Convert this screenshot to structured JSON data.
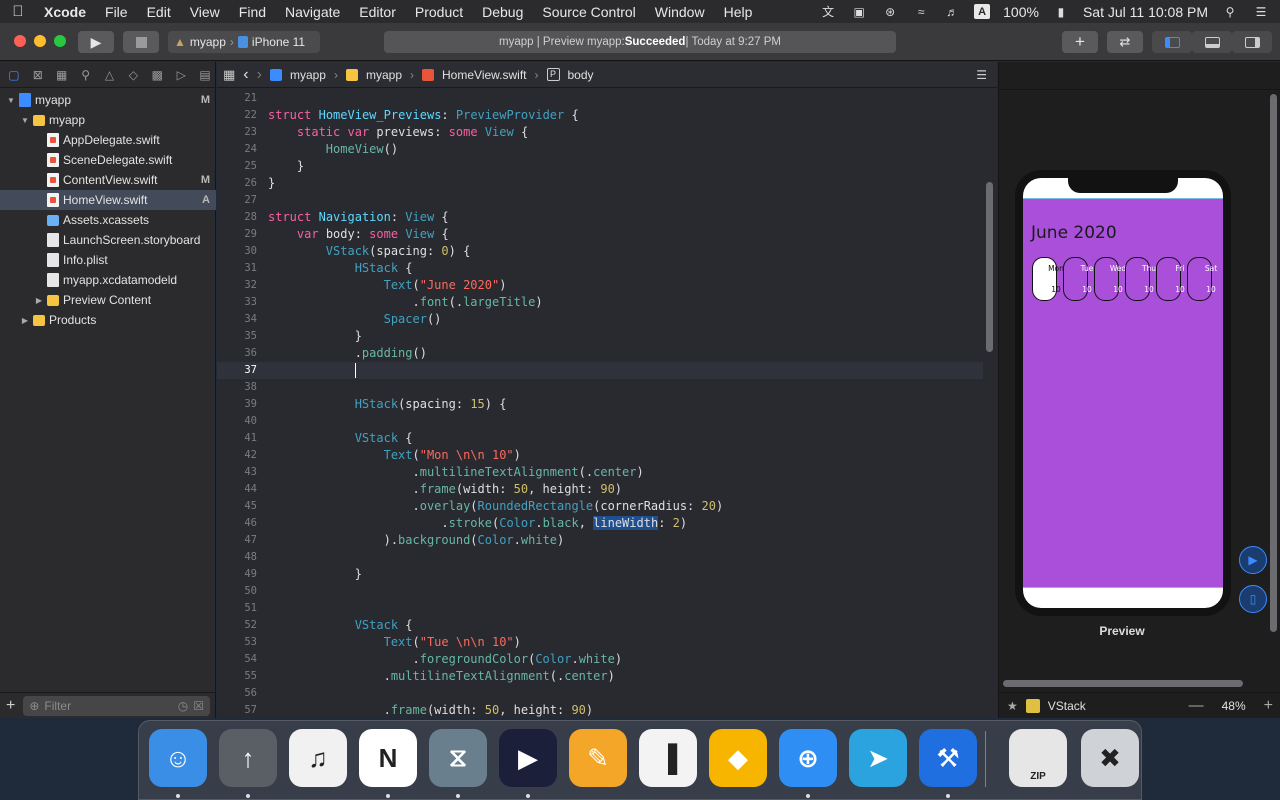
{
  "menubar": {
    "items": [
      "Xcode",
      "File",
      "Edit",
      "View",
      "Find",
      "Navigate",
      "Editor",
      "Product",
      "Debug",
      "Source Control",
      "Window",
      "Help"
    ],
    "battery": "100%",
    "clock": "Sat Jul 11  10:08 PM",
    "input_source": "A"
  },
  "toolbar": {
    "scheme": "myapp",
    "device": "iPhone 11",
    "activity_prefix": "myapp | Preview myapp: ",
    "activity_status": "Succeeded",
    "activity_suffix": " | Today at 9:27 PM"
  },
  "navigator": {
    "items": [
      {
        "label": "myapp",
        "badge": "M",
        "kind": "proj",
        "level": 0,
        "disclosure": "open"
      },
      {
        "label": "myapp",
        "badge": "",
        "kind": "folder",
        "level": 1,
        "disclosure": "open"
      },
      {
        "label": "AppDelegate.swift",
        "badge": "",
        "kind": "swift",
        "level": 2,
        "disclosure": ""
      },
      {
        "label": "SceneDelegate.swift",
        "badge": "",
        "kind": "swift",
        "level": 2,
        "disclosure": ""
      },
      {
        "label": "ContentView.swift",
        "badge": "M",
        "kind": "swift",
        "level": 2,
        "disclosure": ""
      },
      {
        "label": "HomeView.swift",
        "badge": "A",
        "kind": "swift",
        "level": 2,
        "disclosure": "",
        "selected": true
      },
      {
        "label": "Assets.xcassets",
        "badge": "",
        "kind": "assets",
        "level": 2,
        "disclosure": ""
      },
      {
        "label": "LaunchScreen.storyboard",
        "badge": "",
        "kind": "doc",
        "level": 2,
        "disclosure": ""
      },
      {
        "label": "Info.plist",
        "badge": "",
        "kind": "doc",
        "level": 2,
        "disclosure": ""
      },
      {
        "label": "myapp.xcdatamodeld",
        "badge": "",
        "kind": "doc",
        "level": 2,
        "disclosure": ""
      },
      {
        "label": "Preview Content",
        "badge": "",
        "kind": "folder",
        "level": 2,
        "disclosure": "closed"
      },
      {
        "label": "Products",
        "badge": "",
        "kind": "folder",
        "level": 1,
        "disclosure": "closed"
      }
    ],
    "filter_placeholder": "Filter"
  },
  "jumpbar": {
    "crumbs": [
      "myapp",
      "myapp",
      "HomeView.swift",
      "body"
    ]
  },
  "code": {
    "current_line": 37,
    "lines": [
      {
        "n": 21,
        "html": ""
      },
      {
        "n": 22,
        "html": "<span class='kw'>struct</span> <span class='dec'>HomeView_Previews</span>: <span class='tyn'>PreviewProvider</span> {"
      },
      {
        "n": 23,
        "html": "    <span class='kw'>static</span> <span class='kw'>var</span> previews: <span class='kw'>some</span> <span class='tyn'>View</span> {"
      },
      {
        "n": 24,
        "html": "        <span class='fn'>HomeView</span>()"
      },
      {
        "n": 25,
        "html": "    }"
      },
      {
        "n": 26,
        "html": "}"
      },
      {
        "n": 27,
        "html": ""
      },
      {
        "n": 28,
        "html": "<span class='kw'>struct</span> <span class='dec'>Navigation</span>: <span class='tyn'>View</span> {"
      },
      {
        "n": 29,
        "html": "    <span class='kw'>var</span> body: <span class='kw'>some</span> <span class='tyn'>View</span> {"
      },
      {
        "n": 30,
        "html": "        <span class='tyn'>VStack</span>(spacing: <span class='num'>0</span>) {"
      },
      {
        "n": 31,
        "html": "            <span class='tyn'>HStack</span> {"
      },
      {
        "n": 32,
        "html": "                <span class='tyn'>Text</span>(<span class='str'>\"June 2020\"</span>)"
      },
      {
        "n": 33,
        "html": "                    .<span class='fn'>font</span>(.<span class='fn'>largeTitle</span>)"
      },
      {
        "n": 34,
        "html": "                <span class='tyn'>Spacer</span>()"
      },
      {
        "n": 35,
        "html": "            }"
      },
      {
        "n": 36,
        "html": "            .<span class='fn'>padding</span>()"
      },
      {
        "n": 37,
        "html": "            <span class='cursor'></span>"
      },
      {
        "n": 38,
        "html": ""
      },
      {
        "n": 39,
        "html": "            <span class='tyn'>HStack</span>(spacing: <span class='num'>15</span>) {"
      },
      {
        "n": 40,
        "html": ""
      },
      {
        "n": 41,
        "html": "            <span class='tyn'>VStack</span> {"
      },
      {
        "n": 42,
        "html": "                <span class='tyn'>Text</span>(<span class='str'>\"Mon \\n\\n 10\"</span>)"
      },
      {
        "n": 43,
        "html": "                    .<span class='fn'>multilineTextAlignment</span>(.<span class='fn'>center</span>)"
      },
      {
        "n": 44,
        "html": "                    .<span class='fn'>frame</span>(width: <span class='num'>50</span>, height: <span class='num'>90</span>)"
      },
      {
        "n": 45,
        "html": "                    .<span class='fn'>overlay</span>(<span class='tyn'>RoundedRectangle</span>(cornerRadius: <span class='num'>20</span>)"
      },
      {
        "n": 46,
        "html": "                        .<span class='fn'>stroke</span>(<span class='tyn'>Color</span>.<span class='fn'>black</span>, <span class='hl'>lineWidth</span>: <span class='num'>2</span>)"
      },
      {
        "n": 47,
        "html": "                ).<span class='fn'>background</span>(<span class='tyn'>Color</span>.<span class='fn'>white</span>)"
      },
      {
        "n": 48,
        "html": ""
      },
      {
        "n": 49,
        "html": "            }"
      },
      {
        "n": 50,
        "html": ""
      },
      {
        "n": 51,
        "html": ""
      },
      {
        "n": 52,
        "html": "            <span class='tyn'>VStack</span> {"
      },
      {
        "n": 53,
        "html": "                <span class='tyn'>Text</span>(<span class='str'>\"Tue \\n\\n 10\"</span>)"
      },
      {
        "n": 54,
        "html": "                    .<span class='fn'>foregroundColor</span>(<span class='tyn'>Color</span>.<span class='fn'>white</span>)"
      },
      {
        "n": 55,
        "html": "                .<span class='fn'>multilineTextAlignment</span>(.<span class='fn'>center</span>)"
      },
      {
        "n": 56,
        "html": ""
      },
      {
        "n": 57,
        "html": "                .<span class='fn'>frame</span>(width: <span class='num'>50</span>, height: <span class='num'>90</span>)"
      }
    ]
  },
  "preview": {
    "title": "June 2020",
    "days": [
      {
        "name": "Mon",
        "date": "10",
        "selected": true
      },
      {
        "name": "Tue",
        "date": "10",
        "selected": false
      },
      {
        "name": "Wed",
        "date": "10",
        "selected": false
      },
      {
        "name": "Thu",
        "date": "10",
        "selected": false
      },
      {
        "name": "Fri",
        "date": "10",
        "selected": false
      },
      {
        "name": "Sat",
        "date": "10",
        "selected": false
      }
    ],
    "label": "Preview",
    "background_color": "#a94fd9"
  },
  "canvas_bottom": {
    "selection": "VStack",
    "zoom": "48%"
  },
  "dock": {
    "apps": [
      {
        "name": "finder-icon",
        "color": "#3a8ee6"
      },
      {
        "name": "launchpad-icon",
        "color": "#5a5f66"
      },
      {
        "name": "music-icon",
        "color": "#f1f1f1"
      },
      {
        "name": "notion-icon",
        "color": "#ffffff"
      },
      {
        "name": "archiver-icon",
        "color": "#6a7f8e"
      },
      {
        "name": "infuse-icon",
        "color": "#1b1f3a"
      },
      {
        "name": "pages-icon",
        "color": "#f4a629"
      },
      {
        "name": "numbers-icon",
        "color": "#f3f3f3"
      },
      {
        "name": "sketch-icon",
        "color": "#f7b500"
      },
      {
        "name": "safari-icon",
        "color": "#2f8ef4"
      },
      {
        "name": "telegram-icon",
        "color": "#2aa3df"
      },
      {
        "name": "xcode-icon",
        "color": "#1f6fe0"
      },
      {
        "name": "zip-archive-icon",
        "color": "#e6e6e6"
      },
      {
        "name": "trash-icon",
        "color": "#cfd3d8"
      }
    ],
    "zip_label": "ZIP"
  }
}
